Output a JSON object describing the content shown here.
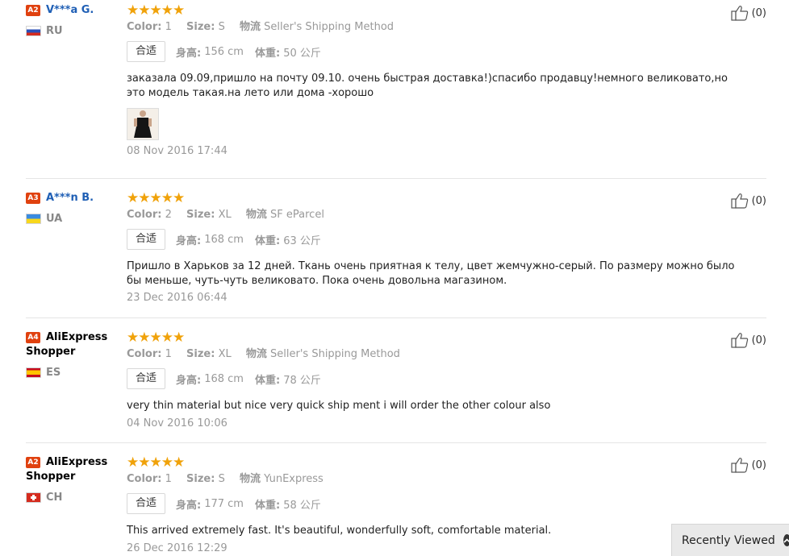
{
  "reviews": [
    {
      "badge": "A2",
      "name": "V***a G.",
      "country": "RU",
      "color_label": "Color:",
      "color": "1",
      "size_label": "Size:",
      "size": "S",
      "shipping_label": "物流",
      "shipping": "Seller's Shipping Method",
      "fit": "合适",
      "height_label": "身高:",
      "height": "156 cm",
      "weight_label": "体重:",
      "weight": "50 公斤",
      "text": "заказала 09.09,пришло на почту 09.10. очень быстрая доставка!)спасибо продавцу!немного великовато,но это модель такая.на лето или дома -хорошо",
      "date": "08 Nov 2016 17:44",
      "likes": "(0)"
    },
    {
      "badge": "A3",
      "name": "A***n B.",
      "country": "UA",
      "color_label": "Color:",
      "color": "2",
      "size_label": "Size:",
      "size": "XL",
      "shipping_label": "物流",
      "shipping": "SF eParcel",
      "fit": "合适",
      "height_label": "身高:",
      "height": "168 cm",
      "weight_label": "体重:",
      "weight": "63 公斤",
      "text": "Пришло в Харьков за 12 дней. Ткань очень приятная к телу, цвет жемчужно-серый. По размеру можно было бы меньше, чуть-чуть великовато. Пока очень довольна магазином.",
      "date": "23 Dec 2016 06:44",
      "likes": "(0)"
    },
    {
      "badge": "A4",
      "name": "AliExpress Shopper",
      "country": "ES",
      "color_label": "Color:",
      "color": "1",
      "size_label": "Size:",
      "size": "XL",
      "shipping_label": "物流",
      "shipping": "Seller's Shipping Method",
      "fit": "合适",
      "height_label": "身高:",
      "height": "168 cm",
      "weight_label": "体重:",
      "weight": "78 公斤",
      "text": "very thin material but nice very quick ship ment i will order the other colour also",
      "date": "04 Nov 2016 10:06",
      "likes": "(0)"
    },
    {
      "badge": "A2",
      "name": "AliExpress Shopper",
      "country": "CH",
      "color_label": "Color:",
      "color": "1",
      "size_label": "Size:",
      "size": "S",
      "shipping_label": "物流",
      "shipping": "YunExpress",
      "fit": "合适",
      "height_label": "身高:",
      "height": "177 cm",
      "weight_label": "体重:",
      "weight": "58 公斤",
      "text": "This arrived extremely fast. It's beautiful, wonderfully soft, comfortable material.",
      "date": "26 Dec 2016 12:29",
      "likes": "(0)"
    }
  ],
  "stars": "★★★★★",
  "recently_viewed": "Recently Viewed"
}
